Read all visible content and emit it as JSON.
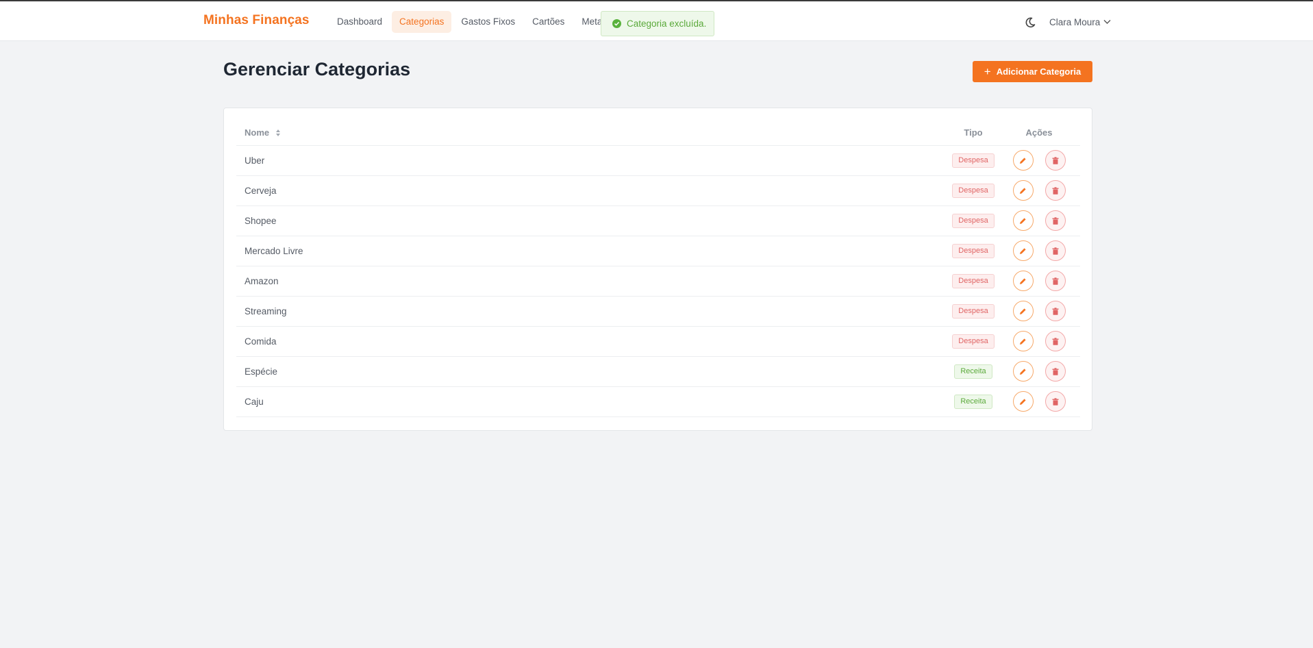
{
  "app": {
    "brand": "Minhas Finanças"
  },
  "nav": [
    {
      "label": "Dashboard",
      "active": false
    },
    {
      "label": "Categorias",
      "active": true
    },
    {
      "label": "Gastos Fixos",
      "active": false
    },
    {
      "label": "Cartões",
      "active": false
    },
    {
      "label": "Metas",
      "active": false
    }
  ],
  "toast": {
    "message": "Categoria excluída."
  },
  "user": {
    "name": "Clara Moura"
  },
  "page": {
    "title": "Gerenciar Categorias",
    "add_button": "Adicionar Categoria"
  },
  "table": {
    "columns": {
      "name": "Nome",
      "type": "Tipo",
      "actions": "Ações"
    },
    "rows": [
      {
        "name": "Uber",
        "type": "Despesa"
      },
      {
        "name": "Cerveja",
        "type": "Despesa"
      },
      {
        "name": "Shopee",
        "type": "Despesa"
      },
      {
        "name": "Mercado Livre",
        "type": "Despesa"
      },
      {
        "name": "Amazon",
        "type": "Despesa"
      },
      {
        "name": "Streaming",
        "type": "Despesa"
      },
      {
        "name": "Comida",
        "type": "Despesa"
      },
      {
        "name": "Espécie",
        "type": "Receita"
      },
      {
        "name": "Caju",
        "type": "Receita"
      }
    ]
  },
  "colors": {
    "accent": "#f47320",
    "expense": "#e06464",
    "income": "#5aa93a"
  },
  "icons": {
    "theme": "moon-icon",
    "user_menu": "chevron-down-icon",
    "toast": "check-circle-icon",
    "add": "plus-icon",
    "sort": "sort-icon",
    "edit": "pencil-icon",
    "delete": "trash-icon"
  }
}
